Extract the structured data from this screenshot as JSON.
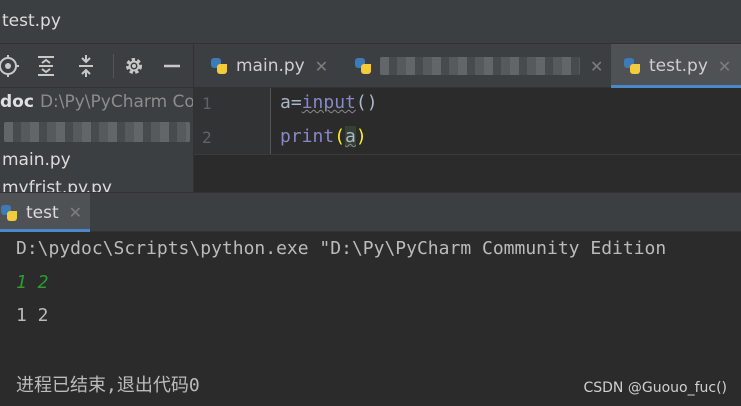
{
  "window": {
    "title": "test.py"
  },
  "project_tree": {
    "root_name": "doc",
    "root_path": "D:\\Py\\PyCharm Co",
    "files": [
      "main.py",
      "myfrist.py.py"
    ]
  },
  "editor": {
    "tabs": [
      {
        "label": "main.py",
        "active": false
      },
      {
        "label": "",
        "active": false,
        "blurred": true
      },
      {
        "label": "test.py",
        "active": true
      }
    ],
    "lines": [
      {
        "number": "1",
        "code_prefix": "a=",
        "fn": "input",
        "code_suffix": "()"
      },
      {
        "number": "2",
        "fn": "print",
        "open": "(",
        "arg": "a",
        "close": ")"
      }
    ]
  },
  "run_panel": {
    "tab_label": "test",
    "output": [
      {
        "text": "D:\\pydoc\\Scripts\\python.exe \"D:\\Py\\PyCharm Community Edition",
        "kind": "command"
      },
      {
        "text": "1 2",
        "kind": "input"
      },
      {
        "text": "1 2",
        "kind": "output"
      },
      {
        "text": "",
        "kind": "blank"
      },
      {
        "text": "进程已结束,退出代码0",
        "kind": "status"
      }
    ]
  },
  "watermark": "CSDN @Guouo_fuc()",
  "colors": {
    "accent": "#4a88c7",
    "console_input": "#2e9b2e",
    "function": "#8888c6",
    "paren_highlight": "#ffef28"
  },
  "icons": [
    "locate-icon",
    "expand-all-icon",
    "collapse-all-icon",
    "gear-icon",
    "minimize-icon",
    "python-file-icon",
    "close-icon"
  ]
}
